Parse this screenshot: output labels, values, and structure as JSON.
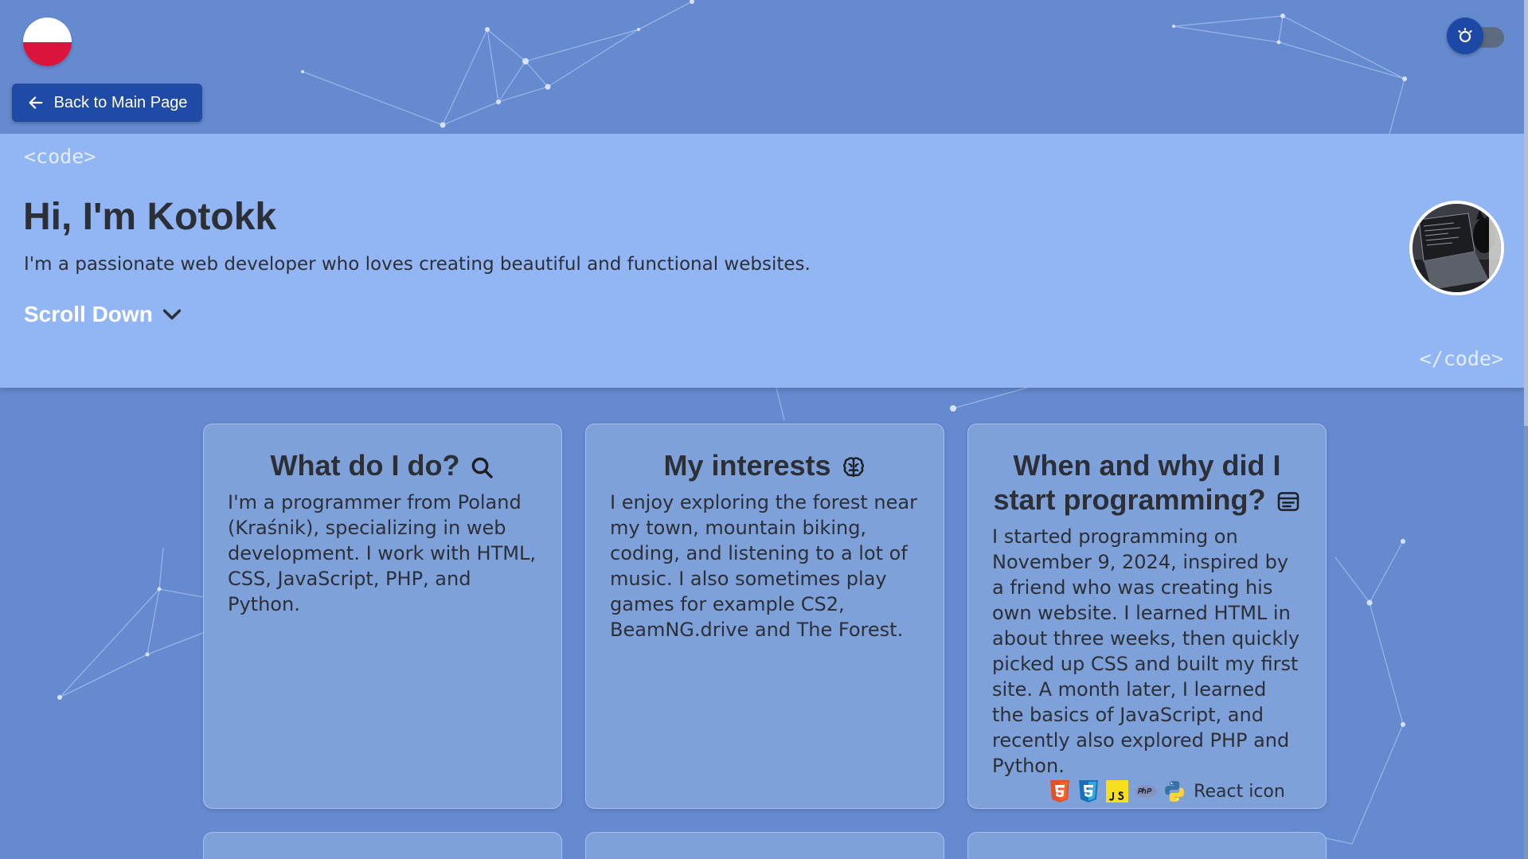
{
  "header": {
    "flag_icon": "poland-flag-icon",
    "back_label": "Back to Main Page",
    "theme_toggle_icon": "sun-icon"
  },
  "hero": {
    "code_open": "<code>",
    "title": "Hi, I'm Kotokk",
    "subtitle": "I'm a passionate web developer who loves creating beautiful and functional websites.",
    "scroll_label": "Scroll Down",
    "code_close": "</code>"
  },
  "cards": [
    {
      "title": "What do I do?",
      "icon": "search-icon",
      "text": "I'm a programmer from Poland (Kraśnik), specializing in web development. I work with HTML, CSS, JavaScript, PHP, and Python."
    },
    {
      "title": "My interests",
      "icon": "brain-icon",
      "text": "I enjoy exploring the forest near my town, mountain biking, coding, and listening to a lot of music. I also sometimes play games for example CS2, BeamNG.drive and The Forest."
    },
    {
      "title": "When and why did I start programming?",
      "icon": "document-icon",
      "text": "I started programming on November 9, 2024, inspired by a friend who was creating his own website. I learned HTML in about three weeks, then quickly picked up CSS and built my first site. A month later, I learned the basics of JavaScript, and recently also explored PHP and Python.",
      "tech_icons": [
        "html5-icon",
        "css3-icon",
        "javascript-icon",
        "php-icon",
        "python-icon"
      ],
      "react_label": "React icon"
    }
  ],
  "colors": {
    "background": "#658ad0",
    "hero": "#92b6f4",
    "button": "#1f4aa6",
    "card": "#7ea1da"
  }
}
